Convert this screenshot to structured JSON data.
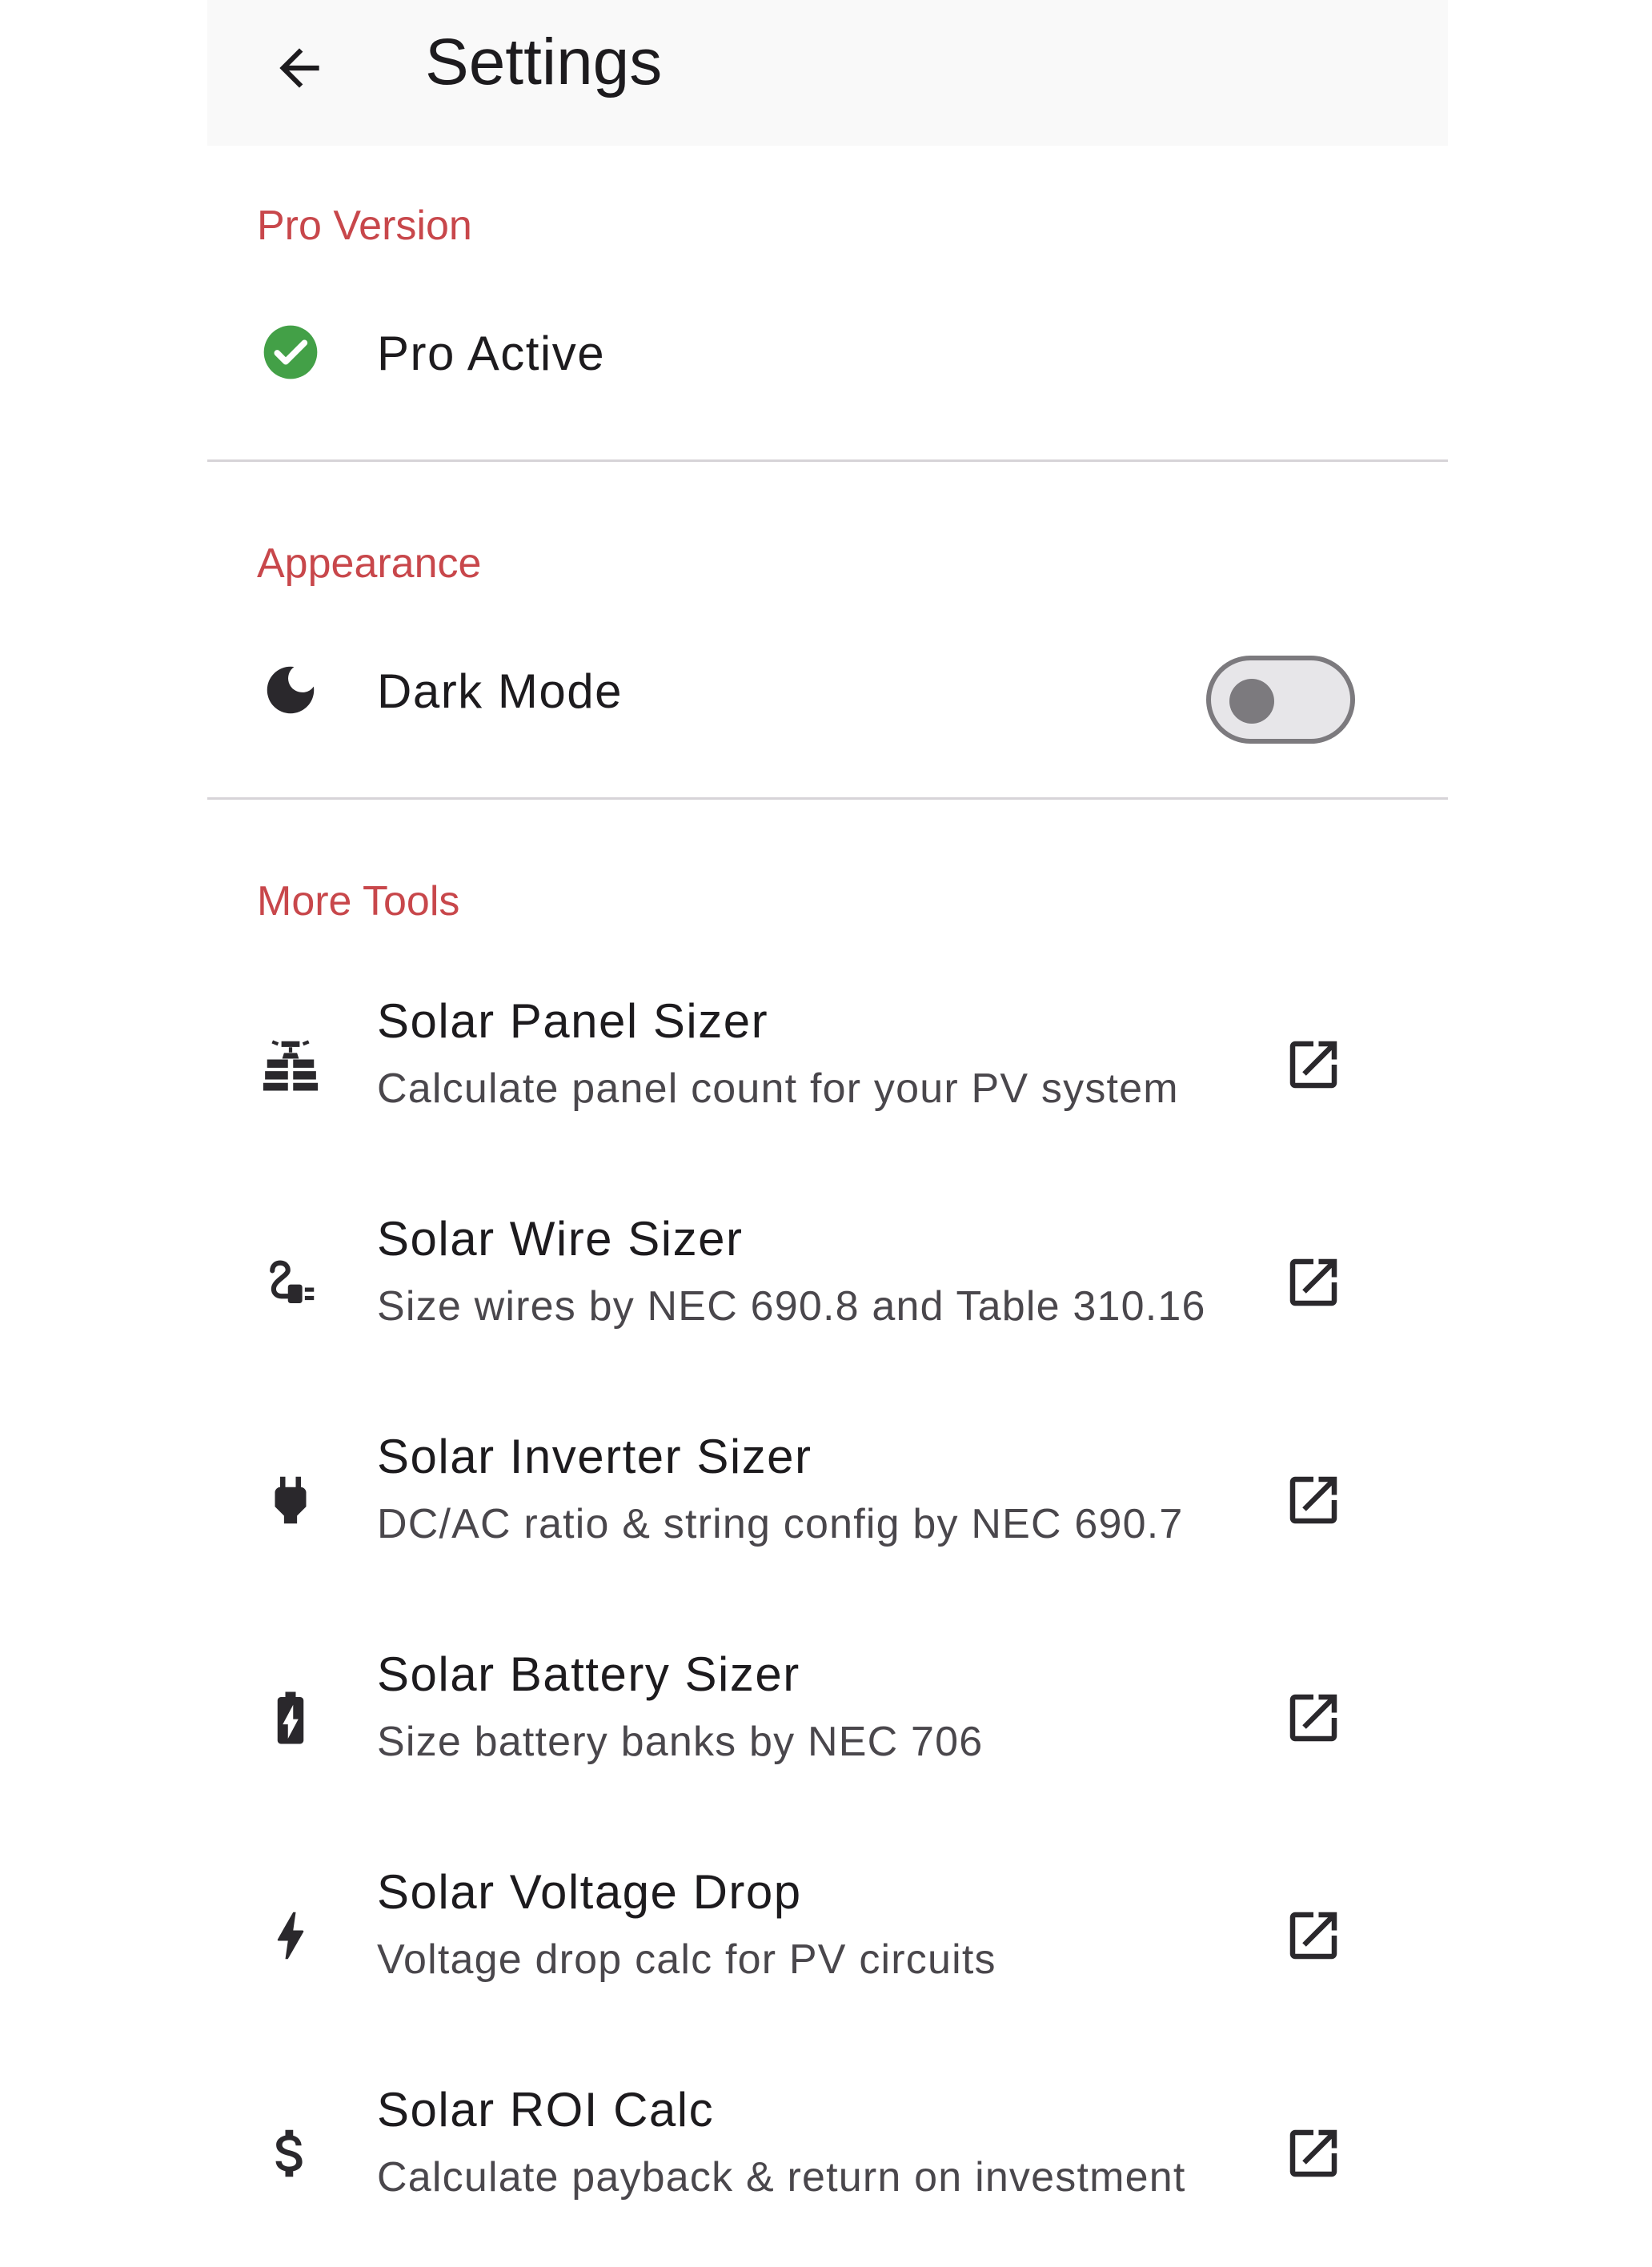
{
  "app_bar": {
    "title": "Settings",
    "back_icon": "arrow-back-icon"
  },
  "sections": {
    "pro": {
      "header": "Pro Version",
      "item": {
        "icon": "check-circle-icon",
        "label": "Pro Active",
        "icon_color": "#43a047"
      }
    },
    "appearance": {
      "header": "Appearance",
      "item": {
        "icon": "moon-icon",
        "label": "Dark Mode",
        "toggle_on": false
      }
    },
    "more_tools": {
      "header": "More Tools",
      "items": [
        {
          "icon": "solar-panel-icon",
          "title": "Solar Panel Sizer",
          "subtitle": "Calculate panel count for your PV system",
          "trailing_icon": "open-in-new-icon"
        },
        {
          "icon": "cable-plug-icon",
          "title": "Solar Wire Sizer",
          "subtitle": "Size wires by NEC 690.8 and Table 310.16",
          "trailing_icon": "open-in-new-icon"
        },
        {
          "icon": "power-plug-icon",
          "title": "Solar Inverter Sizer",
          "subtitle": "DC/AC ratio & string config by NEC 690.7",
          "trailing_icon": "open-in-new-icon"
        },
        {
          "icon": "battery-charging-icon",
          "title": "Solar Battery Sizer",
          "subtitle": "Size battery banks by NEC 706",
          "trailing_icon": "open-in-new-icon"
        },
        {
          "icon": "bolt-icon",
          "title": "Solar Voltage Drop",
          "subtitle": "Voltage drop calc for PV circuits",
          "trailing_icon": "open-in-new-icon"
        },
        {
          "icon": "dollar-icon",
          "title": "Solar ROI Calc",
          "subtitle": "Calculate payback & return on investment",
          "trailing_icon": "open-in-new-icon"
        }
      ]
    }
  },
  "colors": {
    "accent": "#c8474b",
    "app_bar_bg": "#f9f9f9",
    "divider": "#d7d4d8",
    "text_primary": "#1d1b1e",
    "text_secondary": "#4a474c"
  }
}
